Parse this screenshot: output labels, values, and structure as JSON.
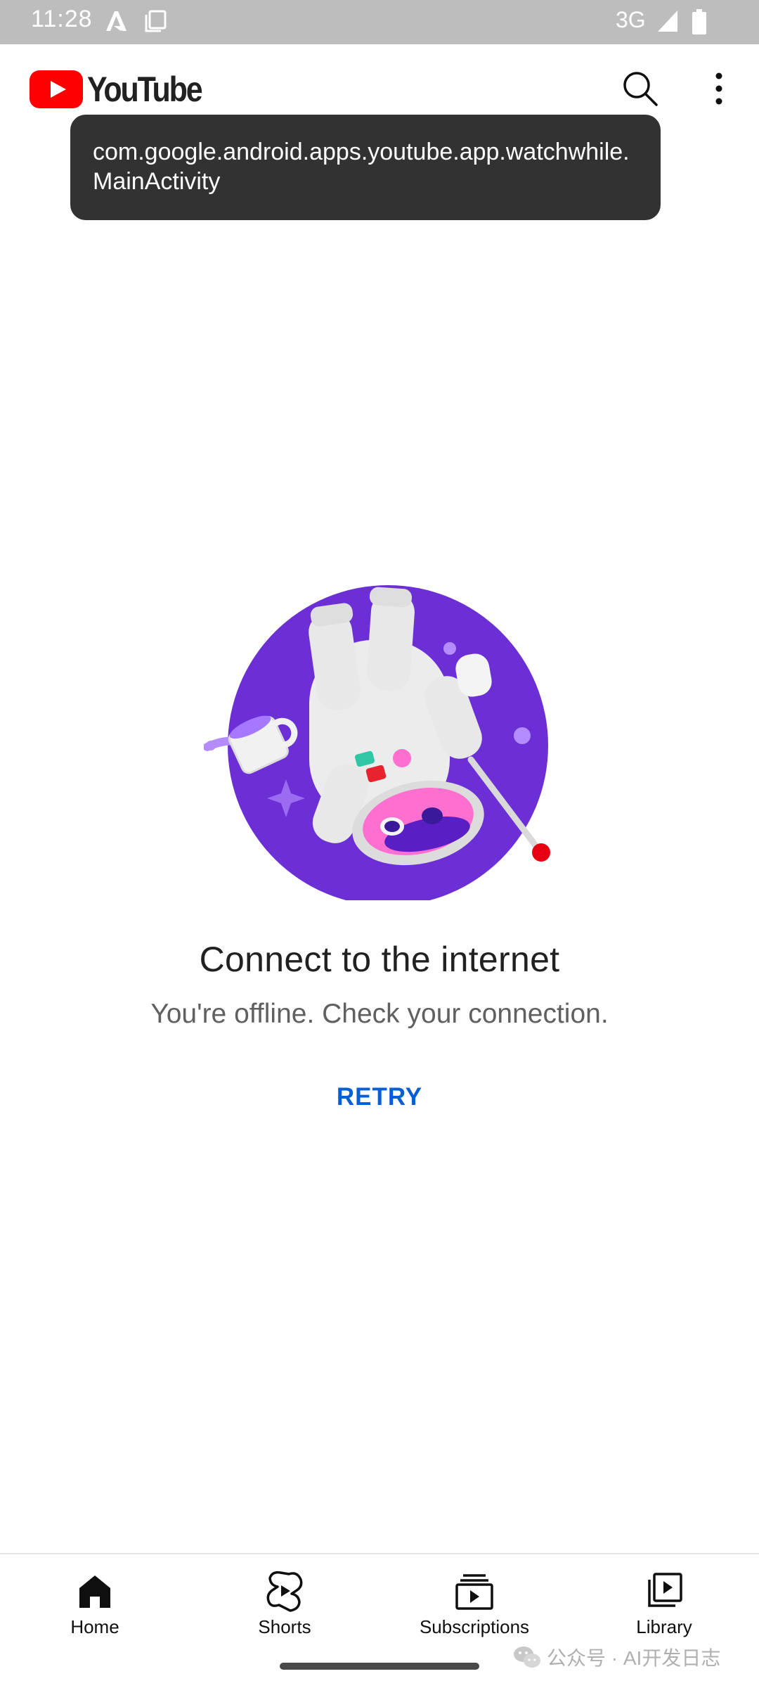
{
  "status_bar": {
    "time": "11:28",
    "network": "3G"
  },
  "app_bar": {
    "logo_text": "YouTube",
    "search_icon": "search-icon",
    "more_icon": "more-vertical-icon"
  },
  "toast": {
    "text": "com.google.android.apps.youtube.app.watchwhile.MainActivity"
  },
  "offline": {
    "title": "Connect to the internet",
    "message": "You're offline. Check your connection.",
    "retry_label": "RETRY"
  },
  "bottom_nav": {
    "items": [
      {
        "label": "Home",
        "icon": "home-icon",
        "selected": true
      },
      {
        "label": "Shorts",
        "icon": "shorts-icon"
      },
      {
        "label": "Subscriptions",
        "icon": "subscriptions-icon"
      },
      {
        "label": "Library",
        "icon": "library-icon"
      }
    ]
  },
  "watermark": {
    "text": "公众号 · AI开发日志"
  },
  "colors": {
    "brand_red": "#ff0000",
    "link_blue": "#065fd4",
    "illustration_purple": "#6c2fd6"
  }
}
